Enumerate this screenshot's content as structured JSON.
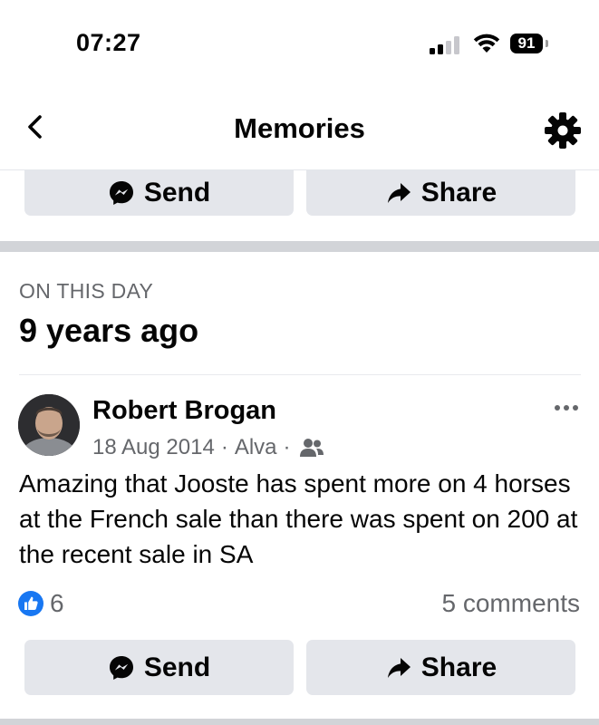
{
  "status_bar": {
    "time": "07:27",
    "battery": "91"
  },
  "nav": {
    "title": "Memories",
    "icons": [
      "chevron-left-icon",
      "gear-icon"
    ]
  },
  "top_actions": {
    "send_label": "Send",
    "share_label": "Share"
  },
  "memory": {
    "section_label": "ON THIS DAY",
    "years_ago": "9 years ago",
    "post": {
      "author": "Robert Brogan",
      "date": "18 Aug 2014",
      "location": "Alva",
      "audience_icon": "friends-icon",
      "text": "Amazing that Jooste has spent more on 4 horses at the French sale than there was spent on 200 at the recent sale in SA",
      "likes": "6",
      "comments": "5 comments",
      "send_label": "Send",
      "share_label": "Share"
    }
  },
  "colors": {
    "accent": "#1877f2",
    "button_bg": "#e4e6eb",
    "secondary_text": "#65676b",
    "separator": "#d2d4d8"
  }
}
